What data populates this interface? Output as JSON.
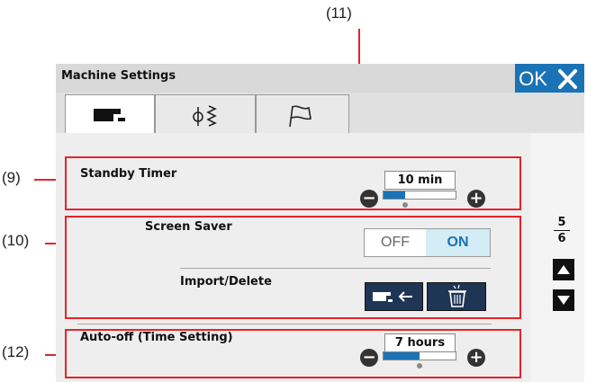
{
  "window": {
    "title": "Machine Settings",
    "ok_label": "OK"
  },
  "tabs": [
    {
      "icon": "sewing-machine-icon",
      "active": true
    },
    {
      "icon": "stitch-icon",
      "active": false
    },
    {
      "icon": "flag-icon",
      "active": false
    }
  ],
  "callouts": {
    "c9": "(9)",
    "c10": "(10)",
    "c11": "(11)",
    "c12": "(12)"
  },
  "standby": {
    "label": "Standby Timer",
    "value": "10 min",
    "slider_fraction": 0.3
  },
  "screensaver": {
    "label": "Screen Saver",
    "off_label": "OFF",
    "on_label": "ON",
    "selected": "ON"
  },
  "import": {
    "label": "Import/Delete"
  },
  "autooff": {
    "label": "Auto-off (Time Setting)",
    "value": "7 hours",
    "slider_fraction": 0.5
  },
  "pager": {
    "current": "5",
    "total": "6"
  },
  "colors": {
    "accent": "#1a73b5",
    "callout_red": "#e8222a",
    "dark_button": "#1f3555"
  }
}
